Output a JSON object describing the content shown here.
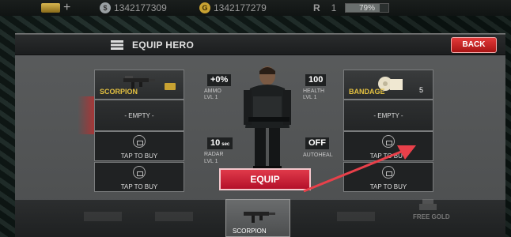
{
  "topbar": {
    "silver_amount": "1342177309",
    "gold_amount": "1342177279",
    "rank_label": "R",
    "rank_value": "1",
    "xp_percent_label": "79%",
    "xp_percent": 79
  },
  "header": {
    "title": "EQUIP HERO",
    "back_label": "BACK"
  },
  "left_slots": {
    "weapon_name": "SCORPION",
    "empty_label": "- EMPTY -",
    "buy1_label": "TAP TO BUY",
    "buy2_label": "TAP TO BUY"
  },
  "right_slots": {
    "item_name": "BANDAGE",
    "item_count": "5",
    "empty_label": "- EMPTY -",
    "buy1_label": "TAP TO BUY",
    "buy2_label": "TAP TO BUY"
  },
  "stats": {
    "ammo_value": "+0%",
    "ammo_label": "AMMO",
    "ammo_level": "LVL 1",
    "health_value": "100",
    "health_label": "HEALTH",
    "health_level": "LVL 1",
    "radar_value": "10",
    "radar_unit": "sec",
    "radar_label": "RADAR",
    "radar_level": "LVL 1",
    "autoheal_value": "OFF",
    "autoheal_label": "AUTOHEAL"
  },
  "equip_label": "EQUIP",
  "bottom": {
    "selected_name": "SCORPION",
    "free_gold_label": "FREE GOLD"
  },
  "colors": {
    "accent_red": "#c41a2c",
    "gold_text": "#e3c040",
    "arrow": "#e8404a"
  }
}
